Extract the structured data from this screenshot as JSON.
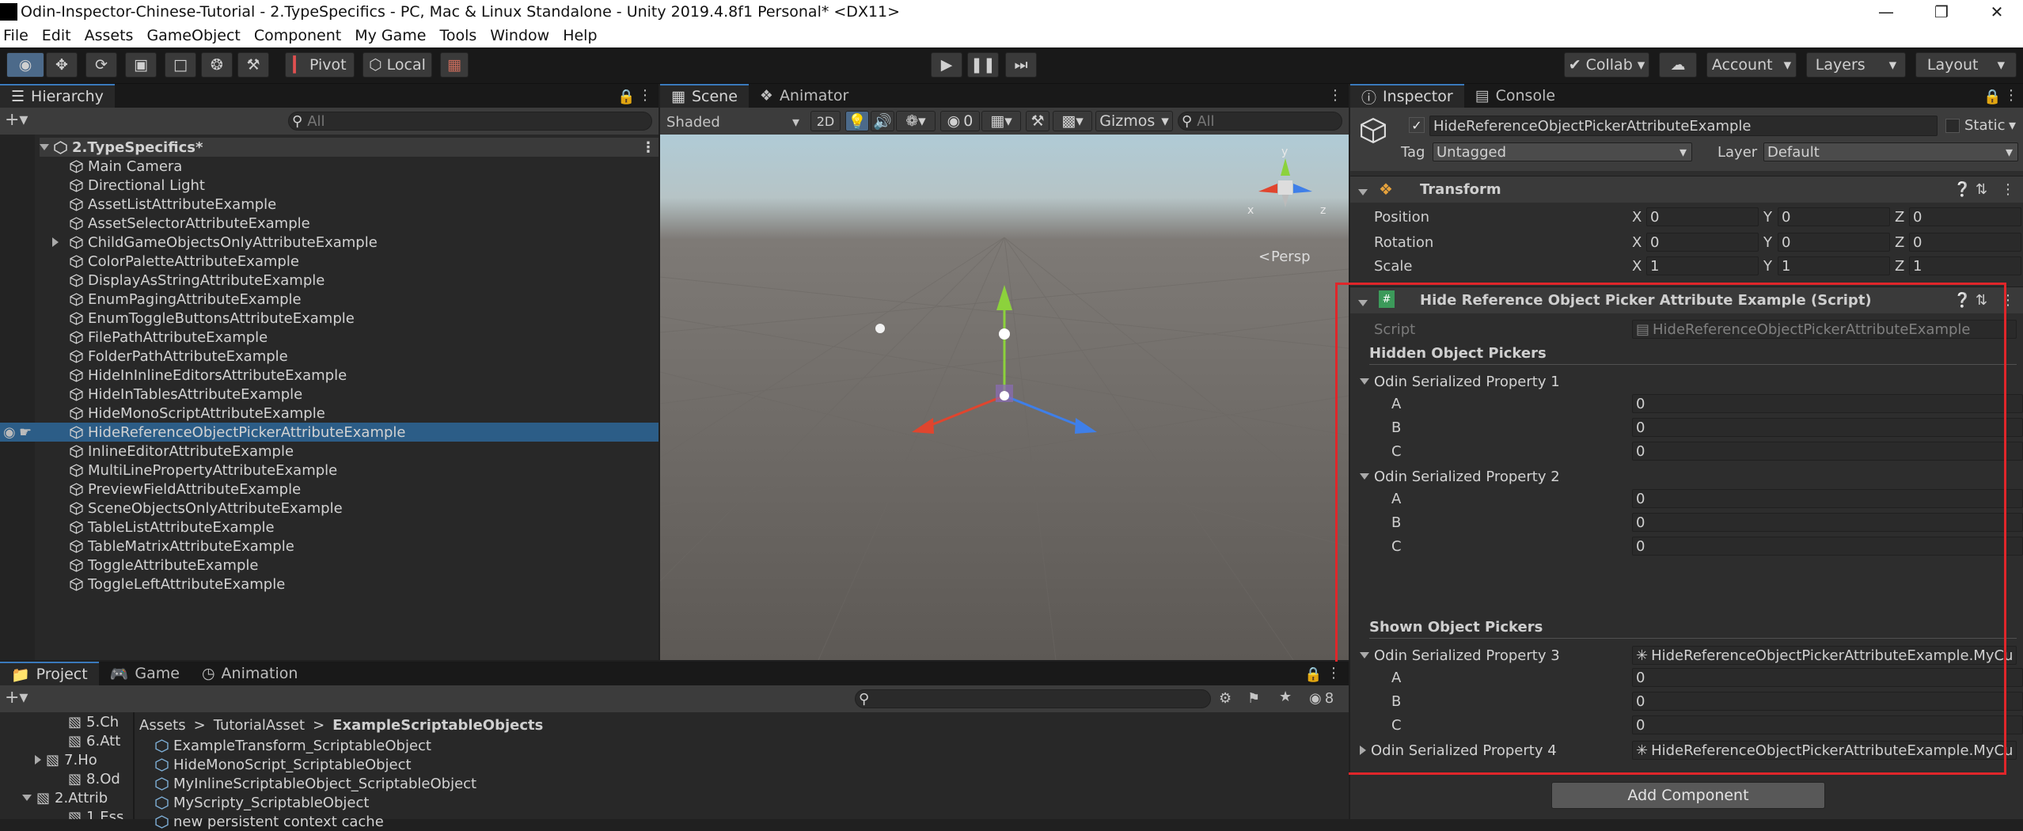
{
  "window": {
    "title": "Odin-Inspector-Chinese-Tutorial - 2.TypeSpecifics - PC, Mac & Linux Standalone - Unity 2019.4.8f1 Personal* <DX11>"
  },
  "menu": [
    "File",
    "Edit",
    "Assets",
    "GameObject",
    "Component",
    "My Game",
    "Tools",
    "Window",
    "Help"
  ],
  "toolbar": {
    "pivot": "Pivot",
    "local": "Local",
    "collab": "Collab",
    "account": "Account",
    "layers": "Layers",
    "layout": "Layout"
  },
  "hierarchy": {
    "tab": "Hierarchy",
    "search_placeholder": "All",
    "scene": "2.TypeSpecifics*",
    "items": [
      "Main Camera",
      "Directional Light",
      "AssetListAttributeExample",
      "AssetSelectorAttributeExample",
      "ChildGameObjectsOnlyAttributeExample",
      "ColorPaletteAttributeExample",
      "DisplayAsStringAttributeExample",
      "EnumPagingAttributeExample",
      "EnumToggleButtonsAttributeExample",
      "FilePathAttributeExample",
      "FolderPathAttributeExample",
      "HideInInlineEditorsAttributeExample",
      "HideInTablesAttributeExample",
      "HideMonoScriptAttributeExample",
      "HideReferenceObjectPickerAttributeExample",
      "InlineEditorAttributeExample",
      "MultiLinePropertyAttributeExample",
      "PreviewFieldAttributeExample",
      "SceneObjectsOnlyAttributeExample",
      "TableListAttributeExample",
      "TableMatrixAttributeExample",
      "ToggleAttributeExample",
      "ToggleLeftAttributeExample"
    ],
    "selected_index": 14
  },
  "scene": {
    "tab_scene": "Scene",
    "tab_animator": "Animator",
    "shading": "Shaded",
    "mode_2d": "2D",
    "hidden_count": "0",
    "gizmos": "Gizmos",
    "search_placeholder": "All",
    "persp": "Persp",
    "axis_x": "x",
    "axis_y": "y",
    "axis_z": "z"
  },
  "project": {
    "tab_project": "Project",
    "tab_game": "Game",
    "tab_animation": "Animation",
    "tree": [
      "5.Ch",
      "6.Att",
      "7.Ho",
      "8.Od",
      "2.Attrib",
      "1.Ess"
    ],
    "breadcrumb": [
      "Assets",
      "TutorialAsset",
      "ExampleScriptableObjects"
    ],
    "files": [
      "ExampleTransform_ScriptableObject",
      "HideMonoScript_ScriptableObject",
      "MyInlineScriptableObject_ScriptableObject",
      "MyScripty_ScriptableObject",
      "new persistent context cache"
    ],
    "hidden_count": "8"
  },
  "inspector": {
    "tab_inspector": "Inspector",
    "tab_console": "Console",
    "object_name": "HideReferenceObjectPickerAttributeExample",
    "static_label": "Static",
    "tag_label": "Tag",
    "tag_value": "Untagged",
    "layer_label": "Layer",
    "layer_value": "Default",
    "transform": {
      "title": "Transform",
      "rows": [
        {
          "label": "Position",
          "x": "0",
          "y": "0",
          "z": "0"
        },
        {
          "label": "Rotation",
          "x": "0",
          "y": "0",
          "z": "0"
        },
        {
          "label": "Scale",
          "x": "1",
          "y": "1",
          "z": "1"
        }
      ],
      "xl": "X",
      "yl": "Y",
      "zl": "Z"
    },
    "script_component": {
      "title": "Hide Reference Object Picker Attribute Example (Script)",
      "script_label": "Script",
      "script_value": "HideReferenceObjectPickerAttributeExample",
      "hidden_header": "Hidden Object Pickers",
      "prop1": "Odin Serialized Property 1",
      "prop2": "Odin Serialized Property 2",
      "shown_header": "Shown Object Pickers",
      "prop3": "Odin Serialized Property 3",
      "prop4": "Odin Serialized Property 4",
      "a": "A",
      "b": "B",
      "c": "C",
      "zero": "0",
      "ref_value": "HideReferenceObjectPickerAttributeExample.MyCu"
    },
    "add_component": "Add Component"
  },
  "colors": {
    "selection": "#2c5d87",
    "highlight_box": "#e0262a",
    "accent": "#3a79bb"
  }
}
